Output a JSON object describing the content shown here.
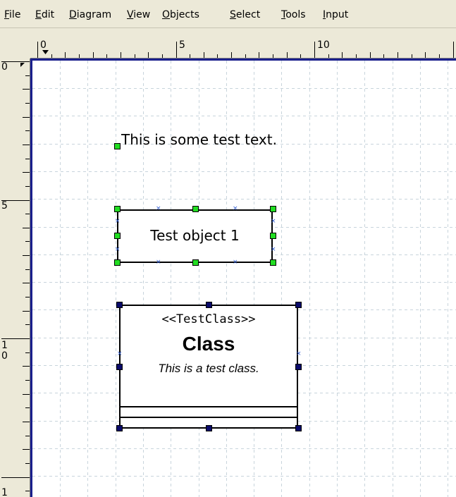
{
  "menu": {
    "items": [
      {
        "first": "F",
        "rest": "ile"
      },
      {
        "first": "E",
        "rest": "dit"
      },
      {
        "first": "D",
        "rest": "iagram"
      },
      {
        "first": "V",
        "rest": "iew"
      },
      {
        "first": "O",
        "rest": "bjects"
      },
      {
        "first": "S",
        "rest": "elect"
      },
      {
        "first": "T",
        "rest": "ools"
      },
      {
        "first": "I",
        "rest": "nput"
      }
    ]
  },
  "ruler": {
    "top_labels": [
      "0",
      "5",
      "10"
    ],
    "left_labels": [
      "0",
      "5",
      "1\n0",
      "1"
    ]
  },
  "canvas": {
    "text_object": "This is some test text.",
    "object1": {
      "label": "Test object 1"
    },
    "class_object": {
      "stereotype": "<<TestClass>>",
      "name": "Class",
      "description": "This is a test class."
    }
  },
  "colors": {
    "selection_green": "#22dd22",
    "selection_navy": "#0a0a6a",
    "canvas_border": "#1a1f8c",
    "grid": "#c8d4dc"
  }
}
